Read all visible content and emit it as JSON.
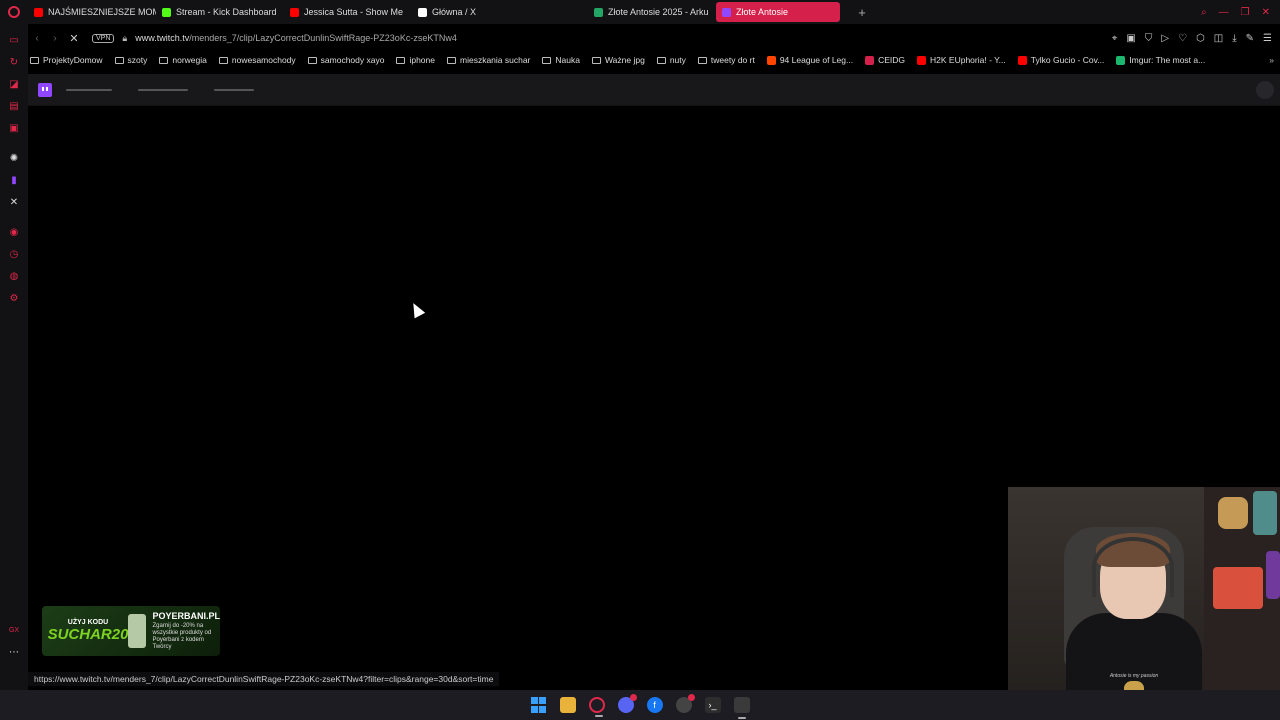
{
  "tabs": [
    {
      "label": "NAJŚMIESZNIEJSZE MOM",
      "favicon_color": "#ff0000"
    },
    {
      "label": "Stream - Kick Dashboard",
      "favicon_color": "#53fc18"
    },
    {
      "label": "Jessica Sutta - Show Me",
      "favicon_color": "#ff0000"
    },
    {
      "label": "Główna / X",
      "favicon_color": "#ffffff"
    },
    {
      "label": "Złote Antosie 2025 - Arku",
      "favicon_color": "#23a566"
    },
    {
      "label": "Złote Antosie",
      "favicon_color": "#9146ff"
    }
  ],
  "address": {
    "vpn_label": "VPN",
    "domain": "www.twitch.tv",
    "path": "/menders_7/clip/LazyCorrectDunlinSwiftRage-PZ23oKc-zseKTNw4"
  },
  "bookmarks": [
    {
      "label": "ProjektyDomow",
      "type": "folder"
    },
    {
      "label": "szoty",
      "type": "folder"
    },
    {
      "label": "norwegia",
      "type": "folder"
    },
    {
      "label": "nowesamochody",
      "type": "folder"
    },
    {
      "label": "samochody xayo",
      "type": "folder"
    },
    {
      "label": "iphone",
      "type": "folder"
    },
    {
      "label": "mieszkania suchar",
      "type": "folder"
    },
    {
      "label": "Nauka",
      "type": "folder"
    },
    {
      "label": "Ważne jpg",
      "type": "folder"
    },
    {
      "label": "nuty",
      "type": "folder"
    },
    {
      "label": "tweety do rt",
      "type": "folder"
    },
    {
      "label": "94 League of Leg...",
      "type": "link",
      "color": "#ff4500"
    },
    {
      "label": "CEIDG",
      "type": "link",
      "color": "#d4204a"
    },
    {
      "label": "H2K EUphoria! - Y...",
      "type": "link",
      "color": "#ff0000"
    },
    {
      "label": "Tylko Gucio - Cov...",
      "type": "link",
      "color": "#ff0000"
    },
    {
      "label": "Imgur: The most a...",
      "type": "link",
      "color": "#1bb76e"
    }
  ],
  "status_url": "https://www.twitch.tv/menders_7/clip/LazyCorrectDunlinSwiftRage-PZ23oKc-zseKTNw4?filter=clips&range=30d&sort=time",
  "promo": {
    "top_text": "UŻYJ KODU",
    "code": "SUCHAR20",
    "site": "POYERBANI.PL",
    "desc": "Zgarnij do -20% na wszystkie produkty od Poyerbani z kodem Twórcy"
  },
  "webcam": {
    "shirt_text": "Antosie is my passion"
  },
  "colors": {
    "accent": "#e0294a",
    "twitch": "#9146ff"
  }
}
